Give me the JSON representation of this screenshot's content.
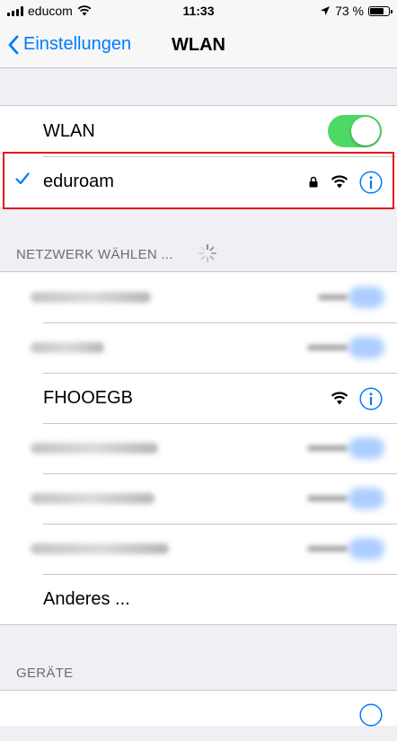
{
  "status_bar": {
    "carrier": "educom",
    "time": "11:33",
    "battery": "73 %",
    "battery_level": 0.73
  },
  "nav": {
    "back_label": "Einstellungen",
    "title": "WLAN"
  },
  "wlan_toggle": {
    "label": "WLAN",
    "on": true,
    "accent_color": "#4cd964"
  },
  "connected_network": {
    "name": "eduroam",
    "secured": true
  },
  "network_section": {
    "header": "NETZWERK WÄHLEN ..."
  },
  "networks": [
    {
      "name": "",
      "blurred": true
    },
    {
      "name": "",
      "blurred": true
    },
    {
      "name": "FHOOEGB",
      "blurred": false
    },
    {
      "name": "",
      "blurred": true
    },
    {
      "name": "",
      "blurred": true
    },
    {
      "name": "",
      "blurred": true
    }
  ],
  "other_network_label": "Anderes ...",
  "devices_section": {
    "header": "GERÄTE"
  },
  "colors": {
    "tint": "#007aff",
    "highlight_border": "#e4161b"
  }
}
